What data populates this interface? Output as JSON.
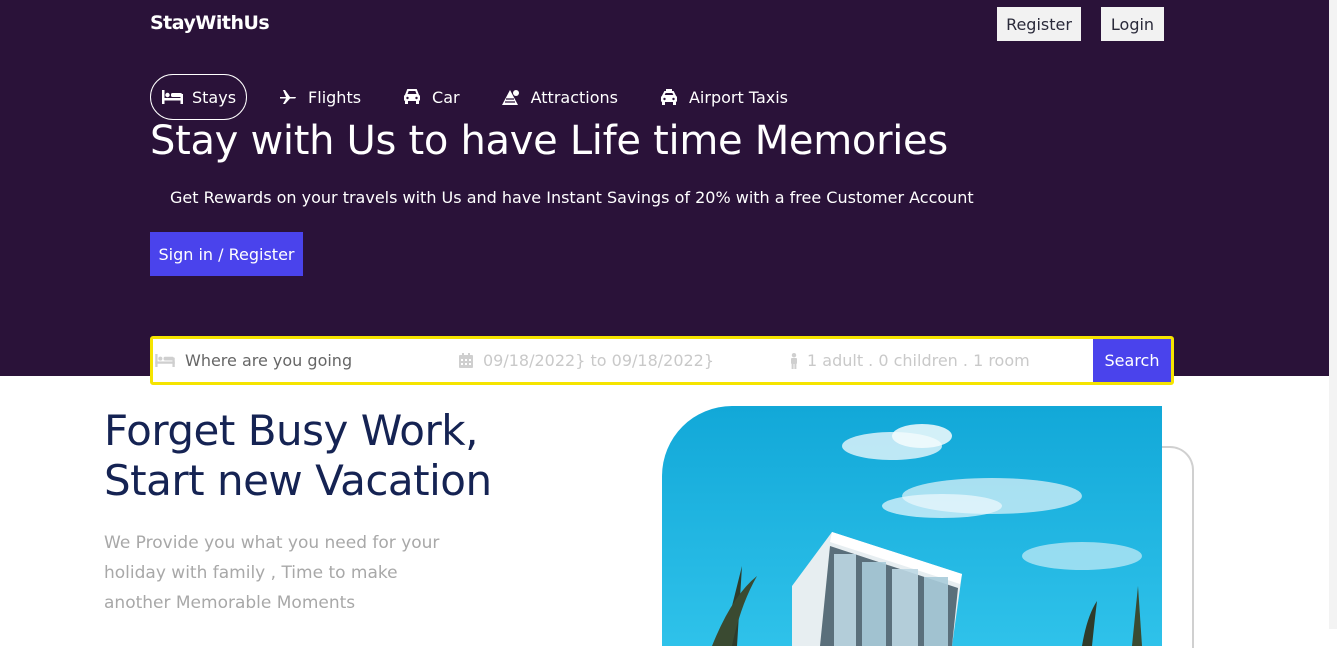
{
  "brand": "StayWithUs",
  "topbar": {
    "register_label": "Register",
    "login_label": "Login"
  },
  "nav": [
    {
      "label": "Stays",
      "icon": "bed-icon",
      "active": true
    },
    {
      "label": "Flights",
      "icon": "plane-icon",
      "active": false
    },
    {
      "label": "Car",
      "icon": "car-icon",
      "active": false
    },
    {
      "label": "Attractions",
      "icon": "attractions-icon",
      "active": false
    },
    {
      "label": "Airport Taxis",
      "icon": "taxi-icon",
      "active": false
    }
  ],
  "hero": {
    "headline": "Stay with Us to have Life time Memories",
    "subtext": "Get Rewards on your travels with Us and have Instant Savings of 20% with a free Customer Account",
    "cta_label": "Sign in / Register"
  },
  "search": {
    "destination_placeholder": "Where are you going",
    "dates": "09/18/2022} to 09/18/2022}",
    "guests": "1 adult . 0 children . 1 room",
    "button_label": "Search"
  },
  "section": {
    "title_line1": "Forget Busy Work,",
    "title_line2": "Start new Vacation",
    "paragraph": "We Provide you what you need for your holiday with family , Time to make another Memorable Moments"
  },
  "colors": {
    "hero_bg": "#2a1239",
    "accent": "#4a43ec",
    "search_border": "#f5e400",
    "heading": "#152353",
    "paragraph": "#a8a8a8"
  }
}
